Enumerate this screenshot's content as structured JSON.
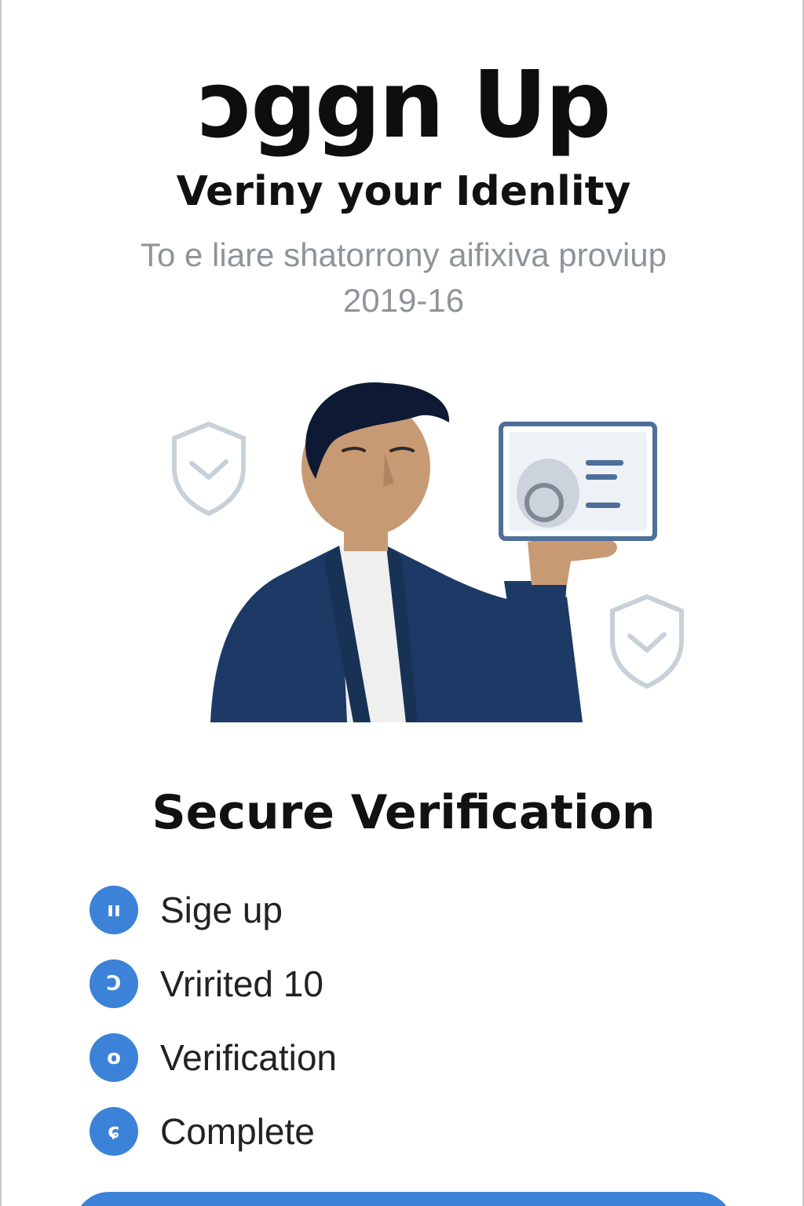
{
  "header": {
    "title": "ɔggn Up",
    "subtitle": "Veriny your Idenlity",
    "description_line1": "To e liare shatorrony aifixiva proviup",
    "description_line2": "2019-16"
  },
  "illustration": {
    "shield_icon": "shield-check-icon",
    "id_card_icon": "id-card-icon"
  },
  "section": {
    "title": "Secure Verification"
  },
  "steps": [
    {
      "icon_text": "ıı",
      "label": "Sige up"
    },
    {
      "icon_text": "Ↄ",
      "label": "Vririted 10"
    },
    {
      "icon_text": "o",
      "label": "Verification"
    },
    {
      "icon_text": "ɕ",
      "label": "Complete"
    }
  ],
  "colors": {
    "accent": "#3b82d8",
    "suit": "#1d3a66",
    "hair": "#0e1a33",
    "skin": "#c89a74",
    "shield": "#c7d1da"
  }
}
